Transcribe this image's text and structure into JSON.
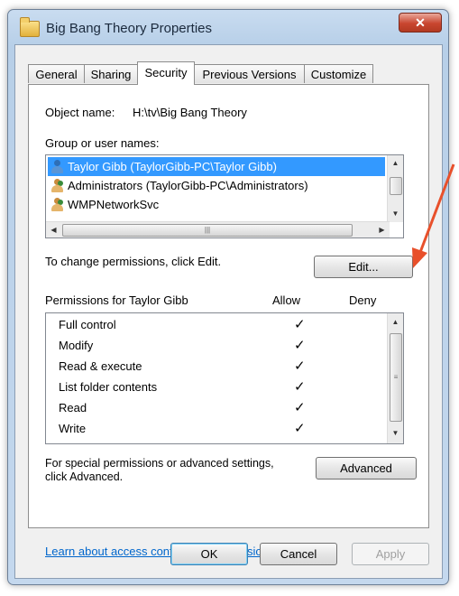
{
  "window": {
    "title": "Big Bang Theory Properties",
    "close_glyph": "✕"
  },
  "tabs": [
    {
      "label": "General"
    },
    {
      "label": "Sharing"
    },
    {
      "label": "Security",
      "active": true
    },
    {
      "label": "Previous Versions"
    },
    {
      "label": "Customize"
    }
  ],
  "security": {
    "object_name_label": "Object name:",
    "object_name_value": "H:\\tv\\Big Bang Theory",
    "group_label": "Group or user names:",
    "users": [
      {
        "name": "Taylor Gibb (TaylorGibb-PC\\Taylor Gibb)",
        "icon": "user-icon",
        "selected": true
      },
      {
        "name": "Administrators (TaylorGibb-PC\\Administrators)",
        "icon": "group-icon"
      },
      {
        "name": "WMPNetworkSvc",
        "icon": "group-icon"
      }
    ],
    "change_text": "To change permissions, click Edit.",
    "edit_button": "Edit...",
    "permissions_for": "Permissions for Taylor Gibb",
    "allow_header": "Allow",
    "deny_header": "Deny",
    "permissions": [
      {
        "name": "Full control",
        "allow": "✓",
        "deny": ""
      },
      {
        "name": "Modify",
        "allow": "✓",
        "deny": ""
      },
      {
        "name": "Read & execute",
        "allow": "✓",
        "deny": ""
      },
      {
        "name": "List folder contents",
        "allow": "✓",
        "deny": ""
      },
      {
        "name": "Read",
        "allow": "✓",
        "deny": ""
      },
      {
        "name": "Write",
        "allow": "✓",
        "deny": ""
      }
    ],
    "special_text_line1": "For special permissions or advanced settings,",
    "special_text_line2": "click Advanced.",
    "advanced_button": "Advanced",
    "learn_link": "Learn about access control and permissions"
  },
  "footer": {
    "ok": "OK",
    "cancel": "Cancel",
    "apply": "Apply"
  },
  "colors": {
    "selection": "#3399ff",
    "annotation_arrow": "#e8502b",
    "link": "#0066cc"
  }
}
